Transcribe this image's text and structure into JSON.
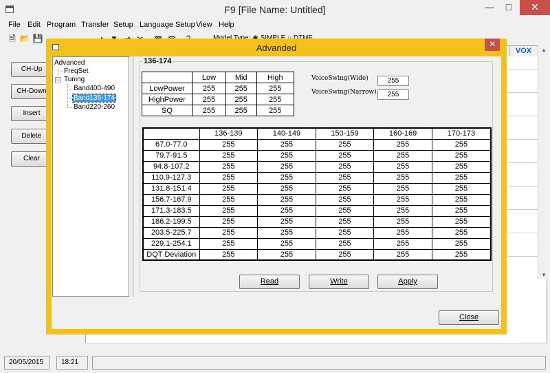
{
  "app": {
    "title": "F9 [File Name: Untitled]",
    "menu": [
      "File",
      "Edit",
      "Program",
      "Transfer",
      "Setup",
      "Language Setup",
      "View",
      "Help"
    ],
    "model_type_text": "Model Type:  ◉ SIMPLE   ○ DTMF",
    "side_buttons": [
      "CH-Up",
      "CH-Down",
      "Insert",
      "Delete",
      "Clear"
    ],
    "grid_header": "VOX",
    "status": {
      "date": "20/05/2015",
      "time": "18:21"
    }
  },
  "dialog": {
    "title": "Advanded",
    "tree": {
      "root": "Advanced",
      "freqset": "FreqSet",
      "tuning": "Tuning",
      "bands": [
        "Band400-490",
        "Band136-174",
        "Band220-260"
      ]
    },
    "group_title": "136-174",
    "power_table": {
      "headers": [
        "",
        "Low",
        "Mid",
        "High"
      ],
      "rows": [
        {
          "label": "LowPower",
          "values": [
            "255",
            "255",
            "255"
          ]
        },
        {
          "label": "HighPower",
          "values": [
            "255",
            "255",
            "255"
          ]
        },
        {
          "label": "SQ",
          "values": [
            "255",
            "255",
            "255"
          ]
        }
      ]
    },
    "voice_swing": {
      "wide_label": "VoiceSwing(Wide)",
      "wide_value": "255",
      "narrow_label": "VoiceSwing(Narrow)",
      "narrow_value": "255"
    },
    "tone_table": {
      "headers": [
        "",
        "136-139",
        "140-149",
        "150-159",
        "160-169",
        "170-173"
      ],
      "rows": [
        {
          "label": "67.0-77.0",
          "values": [
            "255",
            "255",
            "255",
            "255",
            "255"
          ]
        },
        {
          "label": "79.7-91.5",
          "values": [
            "255",
            "255",
            "255",
            "255",
            "255"
          ]
        },
        {
          "label": "94.8-107.2",
          "values": [
            "255",
            "255",
            "255",
            "255",
            "255"
          ]
        },
        {
          "label": "110.9-127.3",
          "values": [
            "255",
            "255",
            "255",
            "255",
            "255"
          ]
        },
        {
          "label": "131.8-151.4",
          "values": [
            "255",
            "255",
            "255",
            "255",
            "255"
          ]
        },
        {
          "label": "156.7-167.9",
          "values": [
            "255",
            "255",
            "255",
            "255",
            "255"
          ]
        },
        {
          "label": "171.3-183.5",
          "values": [
            "255",
            "255",
            "255",
            "255",
            "255"
          ]
        },
        {
          "label": "186.2-199.5",
          "values": [
            "255",
            "255",
            "255",
            "255",
            "255"
          ]
        },
        {
          "label": "203.5-225.7",
          "values": [
            "255",
            "255",
            "255",
            "255",
            "255"
          ]
        },
        {
          "label": "229.1-254.1",
          "values": [
            "255",
            "255",
            "255",
            "255",
            "255"
          ]
        },
        {
          "label": "DQT Deviation",
          "values": [
            "255",
            "255",
            "255",
            "255",
            "255"
          ]
        }
      ]
    },
    "buttons": {
      "read": "Read",
      "write": "Write",
      "apply": "Apply",
      "close": "Close"
    }
  },
  "colors": {
    "dialog_frame": "#f2c21b",
    "close_red": "#c7504b",
    "selection": "#3399ff",
    "vox_blue": "#1c5fd0"
  }
}
